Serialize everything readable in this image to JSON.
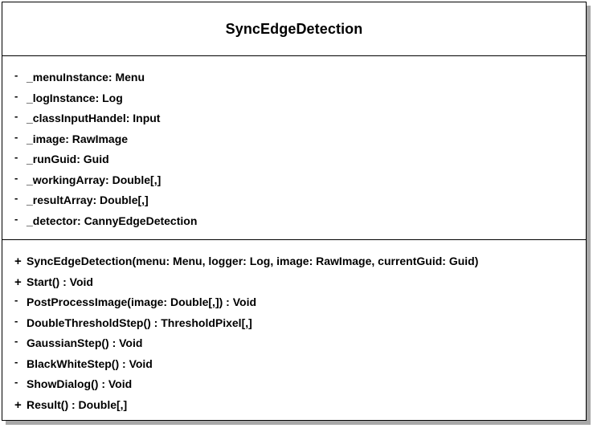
{
  "class": {
    "name": "SyncEdgeDetection",
    "attributes": [
      {
        "visibility": "-",
        "text": "_menuInstance: Menu"
      },
      {
        "visibility": "-",
        "text": "_logInstance: Log"
      },
      {
        "visibility": "-",
        "text": "_classInputHandel: Input"
      },
      {
        "visibility": "-",
        "text": "_image: RawImage"
      },
      {
        "visibility": "-",
        "text": "_runGuid: Guid"
      },
      {
        "visibility": "-",
        "text": "_workingArray: Double[,]"
      },
      {
        "visibility": "-",
        "text": "_resultArray: Double[,]"
      },
      {
        "visibility": "-",
        "text": "_detector: CannyEdgeDetection"
      }
    ],
    "methods": [
      {
        "visibility": "+",
        "text": "SyncEdgeDetection(menu: Menu, logger: Log, image: RawImage, currentGuid: Guid)"
      },
      {
        "visibility": "+",
        "text": "Start() : Void"
      },
      {
        "visibility": "-",
        "text": "PostProcessImage(image: Double[,]) : Void"
      },
      {
        "visibility": "-",
        "text": "DoubleThresholdStep() : ThresholdPixel[,]"
      },
      {
        "visibility": "-",
        "text": "GaussianStep() : Void"
      },
      {
        "visibility": "-",
        "text": "BlackWhiteStep() : Void"
      },
      {
        "visibility": "-",
        "text": "ShowDialog() : Void"
      },
      {
        "visibility": "+",
        "text": "Result() : Double[,]"
      }
    ]
  }
}
